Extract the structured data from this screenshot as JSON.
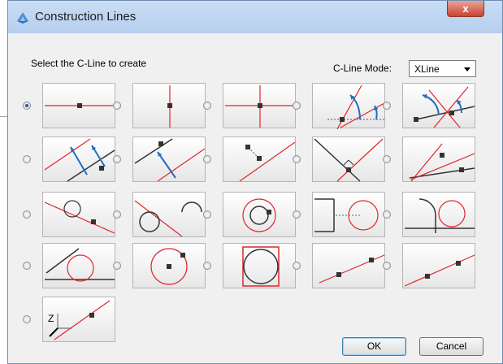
{
  "window": {
    "title": "Construction Lines",
    "close_label": "x"
  },
  "prompt": "Select the C-Line to create",
  "mode": {
    "label": "C-Line Mode:",
    "selected": "XLine"
  },
  "axis_label": "Z",
  "buttons": {
    "ok": "OK",
    "cancel": "Cancel"
  },
  "selected_option": "horizontal",
  "options": [
    "horizontal",
    "vertical",
    "cross",
    "angle",
    "angle-between",
    "parallel-distance",
    "parallel-point",
    "perpendicular",
    "bisector",
    "angle-from-line",
    "tangent-circle-line",
    "tangent-two-circles",
    "tangent-circle-point",
    "tangent-circle-horizontal",
    "tangent-arc-line",
    "tangent-line-circle",
    "circle-center",
    "circle-square",
    "two-points",
    "two-points-extended",
    "z-axis"
  ],
  "colors": {
    "red": "#e0262b",
    "dark": "#333333",
    "blue": "#1f6fc0",
    "selected_radio": "#2a59a8"
  }
}
